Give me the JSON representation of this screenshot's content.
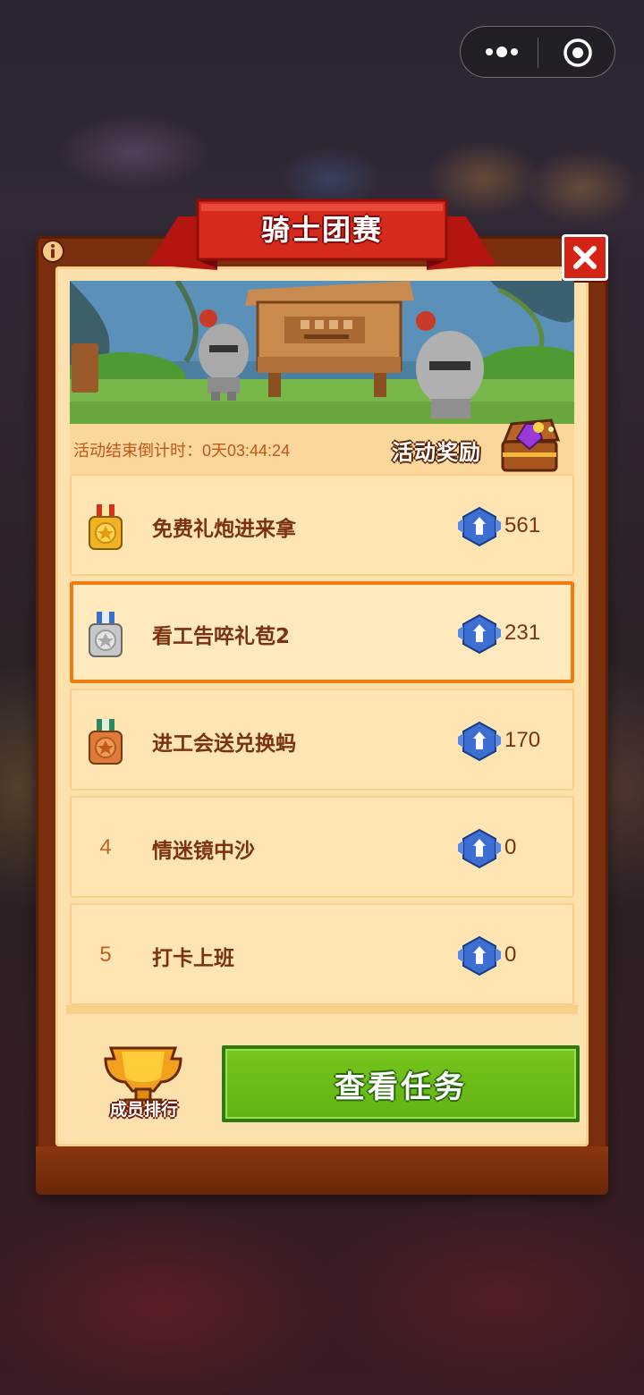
{
  "panel": {
    "title": "骑士团赛",
    "countdown": "活动结束倒计时：0天03:44:24",
    "reward_label": "活动奖励"
  },
  "ranking": [
    {
      "rank": "1",
      "medal": "gold-medal-icon",
      "name": "免费礼炮进来拿",
      "score": "561"
    },
    {
      "rank": "2",
      "medal": "silver-medal-icon",
      "name": "看工告啐礼苞2",
      "score": "231"
    },
    {
      "rank": "3",
      "medal": "bronze-medal-icon",
      "name": "进工会送兑换蚂",
      "score": "170"
    },
    {
      "rank": "4",
      "medal": "",
      "name": "情迷镜中沙",
      "score": "0"
    },
    {
      "rank": "5",
      "medal": "",
      "name": "打卡上班",
      "score": "0"
    }
  ],
  "footer": {
    "member_rank_label": "成员排行",
    "view_tasks_label": "查看任务"
  },
  "colors": {
    "frame": "#7a2e0e",
    "panel_bg": "#fde1ac",
    "highlight_border": "#ef7c0f",
    "button_green": "#6ab916",
    "ribbon_red": "#d0201a"
  }
}
